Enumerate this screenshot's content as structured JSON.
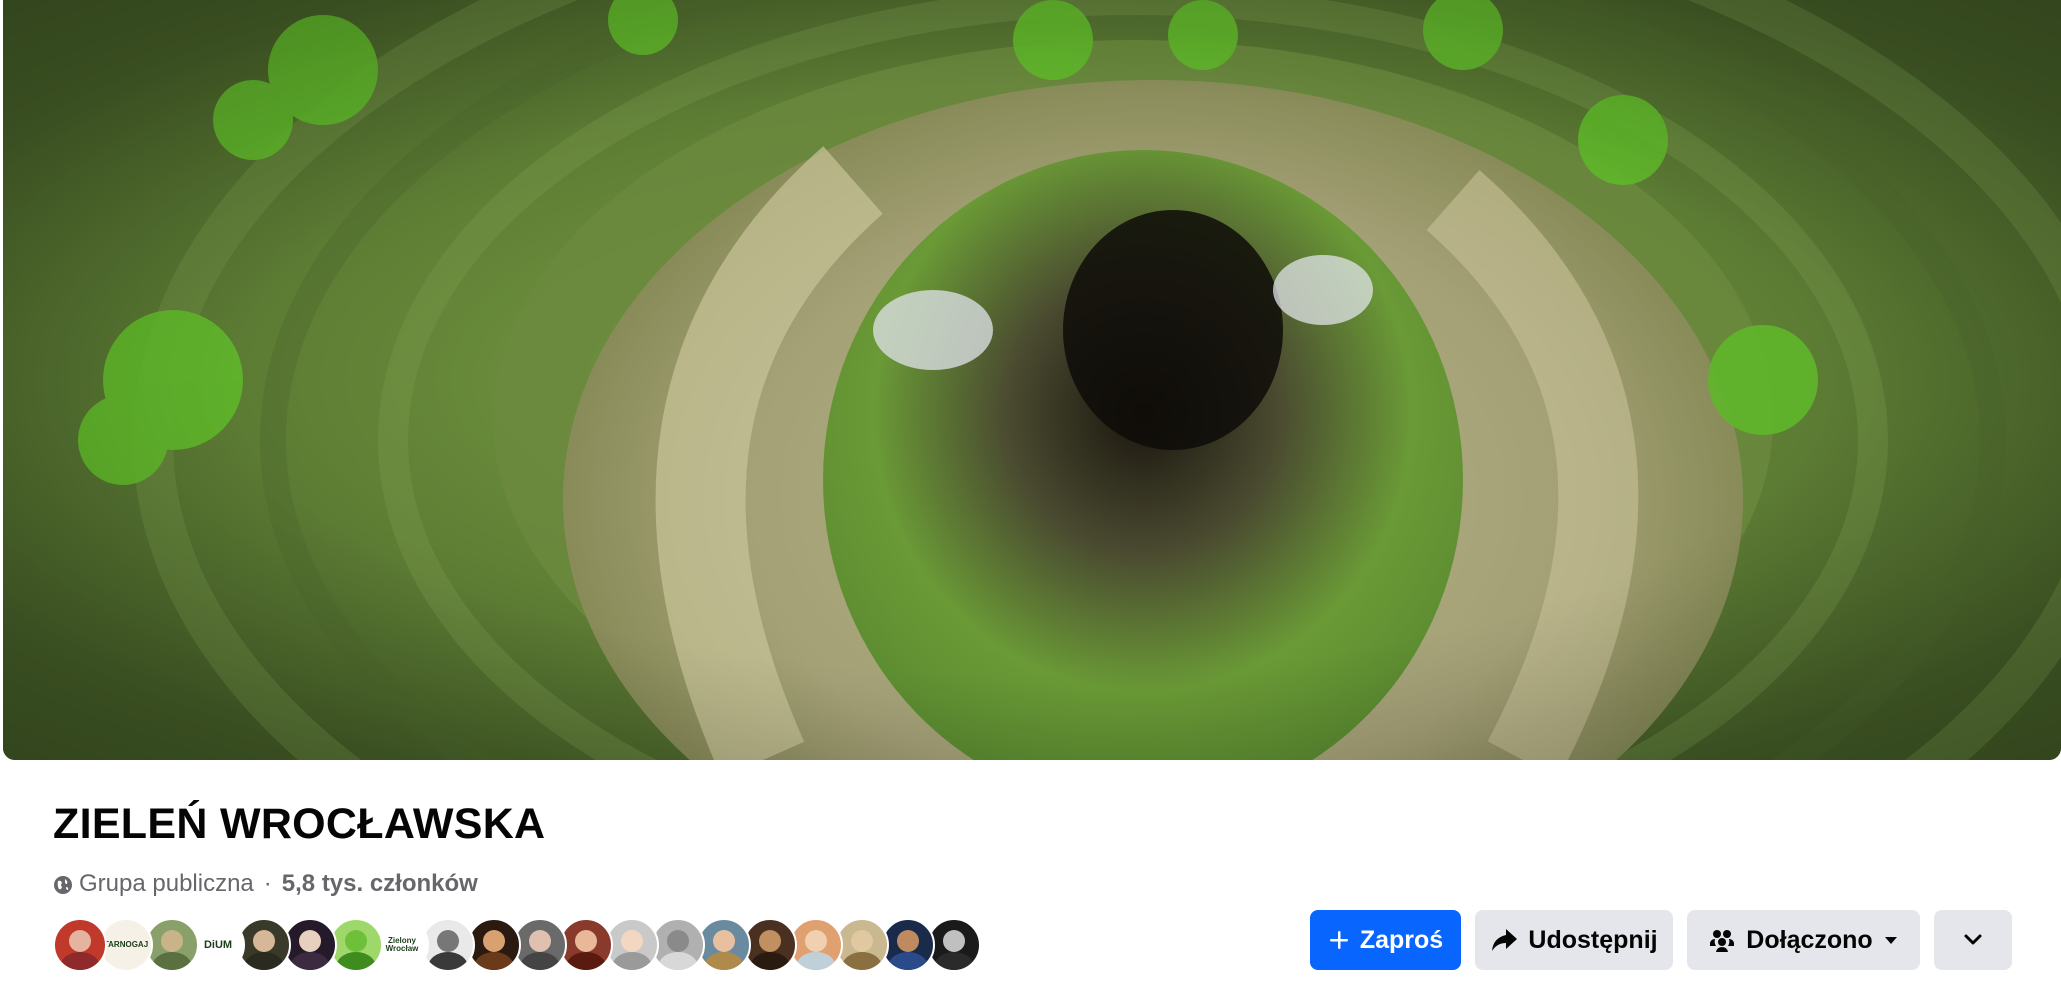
{
  "group": {
    "name": "ZIELEŃ WROCŁAWSKA",
    "privacy": "Grupa publiczna",
    "separator": "·",
    "members": "5,8 tys. członków"
  },
  "member_avatars": [
    {
      "label": "",
      "bg": "#c0392b",
      "skin": "#e6b3a0",
      "cloth": "#8e2a2a"
    },
    {
      "label": "TARNOGAJ",
      "bg": "#f5f1e6",
      "skin": "#d9a441",
      "cloth": "#7a5a1a"
    },
    {
      "label": "",
      "bg": "#8aa06a",
      "skin": "#c9b48a",
      "cloth": "#5a7040"
    },
    {
      "label": "DiUM",
      "bg": "#ffffff",
      "skin": "#ffffff",
      "cloth": "#ffffff"
    },
    {
      "label": "",
      "bg": "#3a3a2a",
      "skin": "#d6b898",
      "cloth": "#2a2a20"
    },
    {
      "label": "",
      "bg": "#241a2a",
      "skin": "#e8d0c0",
      "cloth": "#3b2a40"
    },
    {
      "label": "",
      "bg": "#9fd86a",
      "skin": "#6ec03a",
      "cloth": "#3f8c1e"
    },
    {
      "label": "Zielony Wrocław",
      "bg": "#ffffff",
      "skin": "#2aa86a",
      "cloth": "#1b7f4c"
    },
    {
      "label": "",
      "bg": "#e9e9e9",
      "skin": "#777777",
      "cloth": "#3a3a3a"
    },
    {
      "label": "",
      "bg": "#2a1a10",
      "skin": "#d9a070",
      "cloth": "#6a3a1a"
    },
    {
      "label": "",
      "bg": "#6a6a6a",
      "skin": "#e0c0b0",
      "cloth": "#444444"
    },
    {
      "label": "",
      "bg": "#8a3a2a",
      "skin": "#e8b898",
      "cloth": "#5a1a10"
    },
    {
      "label": "",
      "bg": "#c9c9c9",
      "skin": "#f2d8c0",
      "cloth": "#9a9a9a"
    },
    {
      "label": "",
      "bg": "#b0b0b0",
      "skin": "#8a8a8a",
      "cloth": "#d8d8d8"
    },
    {
      "label": "",
      "bg": "#6a8aa0",
      "skin": "#e8c0a0",
      "cloth": "#b08a4a"
    },
    {
      "label": "",
      "bg": "#4a3020",
      "skin": "#c09060",
      "cloth": "#2a1a10"
    },
    {
      "label": "",
      "bg": "#e0a070",
      "skin": "#f0d0b0",
      "cloth": "#c0d0d8"
    },
    {
      "label": "",
      "bg": "#c9b890",
      "skin": "#e0c8a0",
      "cloth": "#8a7040"
    },
    {
      "label": "",
      "bg": "#1a2a4a",
      "skin": "#c08a60",
      "cloth": "#2a4a8a"
    },
    {
      "label": "",
      "bg": "#1a1a1a",
      "skin": "#c0c0c0",
      "cloth": "#2a2a2a"
    }
  ],
  "actions": {
    "invite": "Zaproś",
    "share": "Udostępnij",
    "joined": "Dołączono"
  },
  "colors": {
    "primary": "#0866ff",
    "secondary": "#e4e6eb",
    "meta_text": "#65676b"
  },
  "icons": {
    "privacy": "globe-icon",
    "invite": "plus-icon",
    "share": "share-icon",
    "joined": "people-icon",
    "joined_caret": "caret-down-icon",
    "more": "chevron-down-icon"
  }
}
